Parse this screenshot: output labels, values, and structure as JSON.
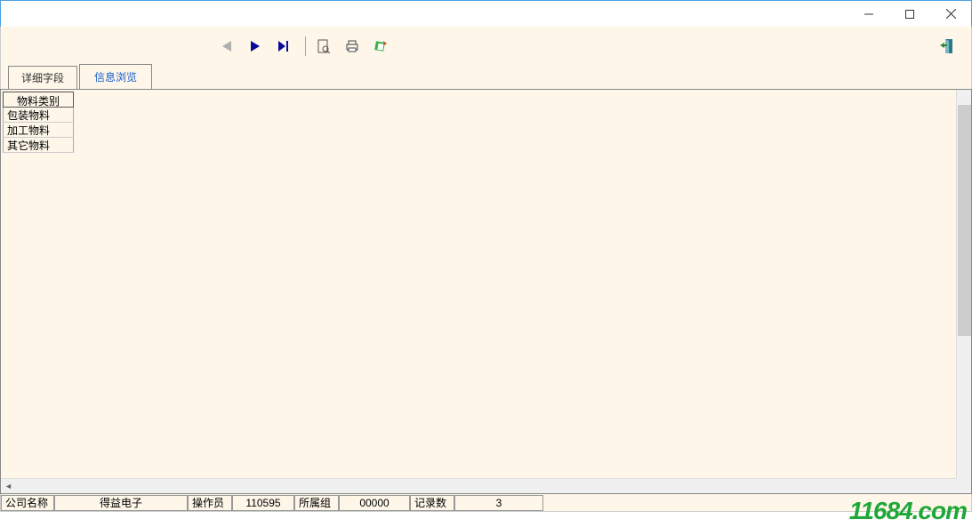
{
  "tabs": {
    "detail": "详细字段",
    "browse": "信息浏览"
  },
  "grid": {
    "header": "物料类别",
    "rows": [
      "包装物料",
      "加工物料",
      "其它物料"
    ]
  },
  "status": {
    "company_label": "公司名称",
    "company_value": "得益电子",
    "operator_label": "操作员",
    "operator_value": "110595",
    "group_label": "所属组",
    "group_value": "00000",
    "record_label": "记录数",
    "record_value": "3"
  },
  "watermark": "11684.com"
}
